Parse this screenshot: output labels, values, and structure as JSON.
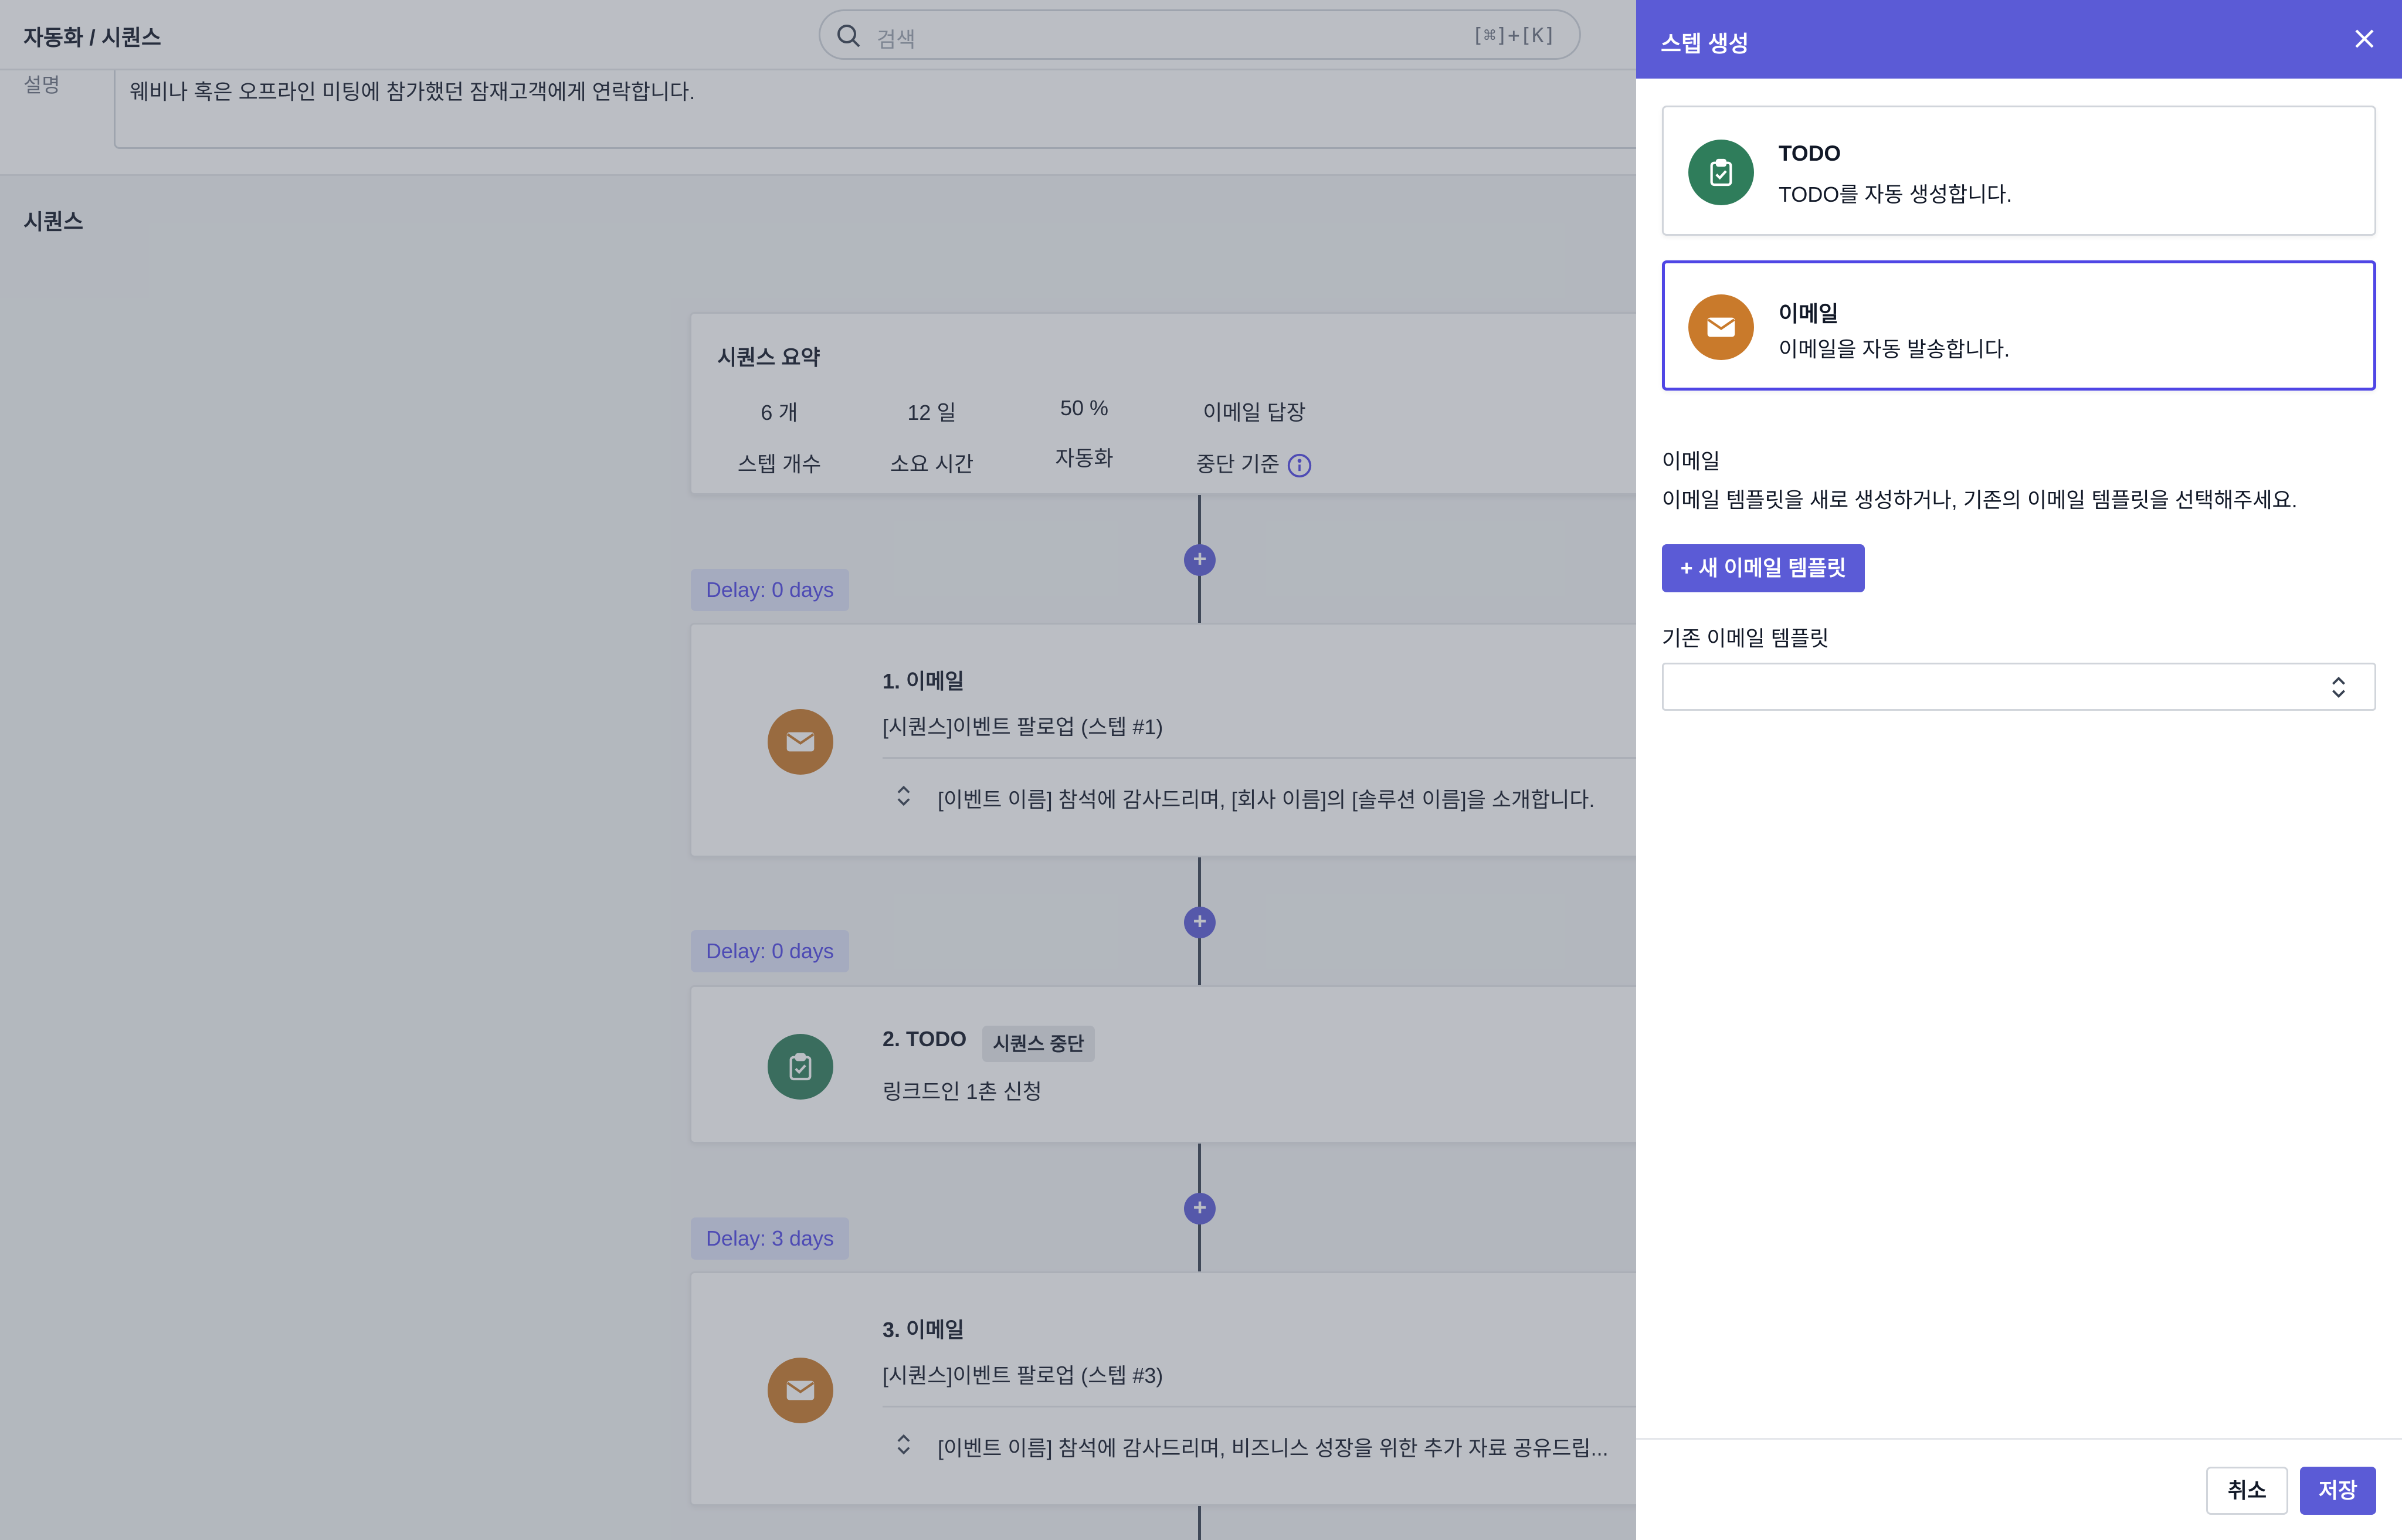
{
  "topbar": {
    "breadcrumb": "자동화 / 시퀀스",
    "search_placeholder": "검색",
    "search_shortcut": "[⌘]+[K]"
  },
  "description": {
    "label": "설명",
    "text": "웨비나 혹은 오프라인 미팅에 참가했던 잠재고객에게 연락합니다."
  },
  "sequence": {
    "title": "시퀀스",
    "summary": {
      "title": "시퀀스 요약",
      "stats": [
        {
          "value": "6 개",
          "label": "스텝 개수"
        },
        {
          "value": "12 일",
          "label": "소요 시간"
        },
        {
          "value": "50 %",
          "label": "자동화"
        },
        {
          "value": "이메일 답장",
          "label": "중단 기준"
        }
      ]
    },
    "steps": [
      {
        "delay": "Delay: 0 days",
        "title": "1. 이메일",
        "subject": "[시퀀스]이벤트 팔로업 (스텝 #1)",
        "preview": "[이벤트 이름] 참석에 감사드리며, [회사 이름]의 [솔루션 이름]을 소개합니다.",
        "icon": "envelope-icon"
      },
      {
        "delay": "Delay: 0 days",
        "title": "2. TODO",
        "badge": "시퀀스 중단",
        "subject": "링크드인 1촌 신청",
        "icon": "clipboard-check-icon"
      },
      {
        "delay": "Delay: 3 days",
        "title": "3. 이메일",
        "subject": "[시퀀스]이벤트 팔로업 (스텝 #3)",
        "preview": "[이벤트 이름] 참석에 감사드리며, 비즈니스 성장을 위한 추가 자료 공유드립...",
        "icon": "envelope-icon"
      }
    ]
  },
  "drawer": {
    "title": "스텝 생성",
    "types": [
      {
        "title": "TODO",
        "desc": "TODO를 자동 생성합니다.",
        "icon": "clipboard-check-icon",
        "selected": false
      },
      {
        "title": "이메일",
        "desc": "이메일을 자동 발송합니다.",
        "icon": "envelope-icon",
        "selected": true
      }
    ],
    "section_label": "이메일",
    "section_help": "이메일 템플릿을 새로 생성하거나, 기존의 이메일 템플릿을 선택해주세요.",
    "new_template_label": "+ 새 이메일 템플릿",
    "existing_label": "기존 이메일 템플릿",
    "existing_value": "",
    "cancel_label": "취소",
    "save_label": "저장"
  },
  "colors": {
    "accent": "#5b5bd6",
    "email_icon": "#c97a2b",
    "todo_icon": "#2f7d5b",
    "delay_badge_bg": "#dbe1f7"
  }
}
